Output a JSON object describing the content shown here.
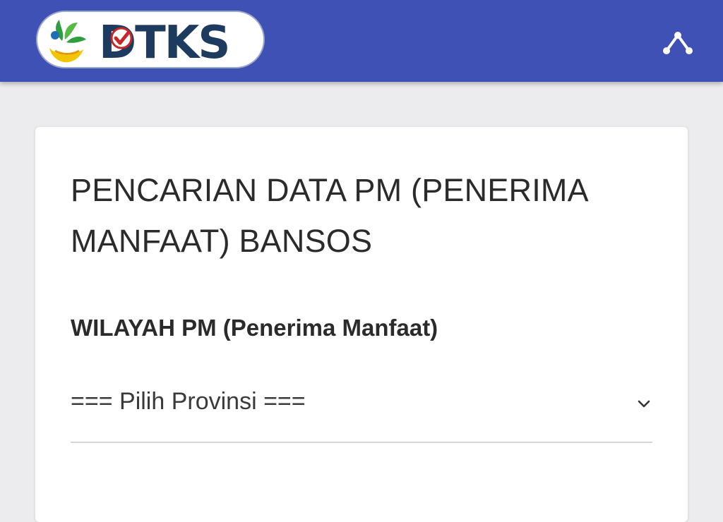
{
  "header": {
    "logo_text": "DTKS",
    "logo_icon": "dtks-logo",
    "menu_icon": "collapse-menu-icon",
    "background": "#3f51b5"
  },
  "card": {
    "title": "PENCARIAN DATA PM (PENERIMA MANFAAT) BANSOS",
    "section_label": "WILAYAH PM (Penerima Manfaat)",
    "province_select": {
      "selected": "=== Pilih Provinsi ==="
    }
  }
}
